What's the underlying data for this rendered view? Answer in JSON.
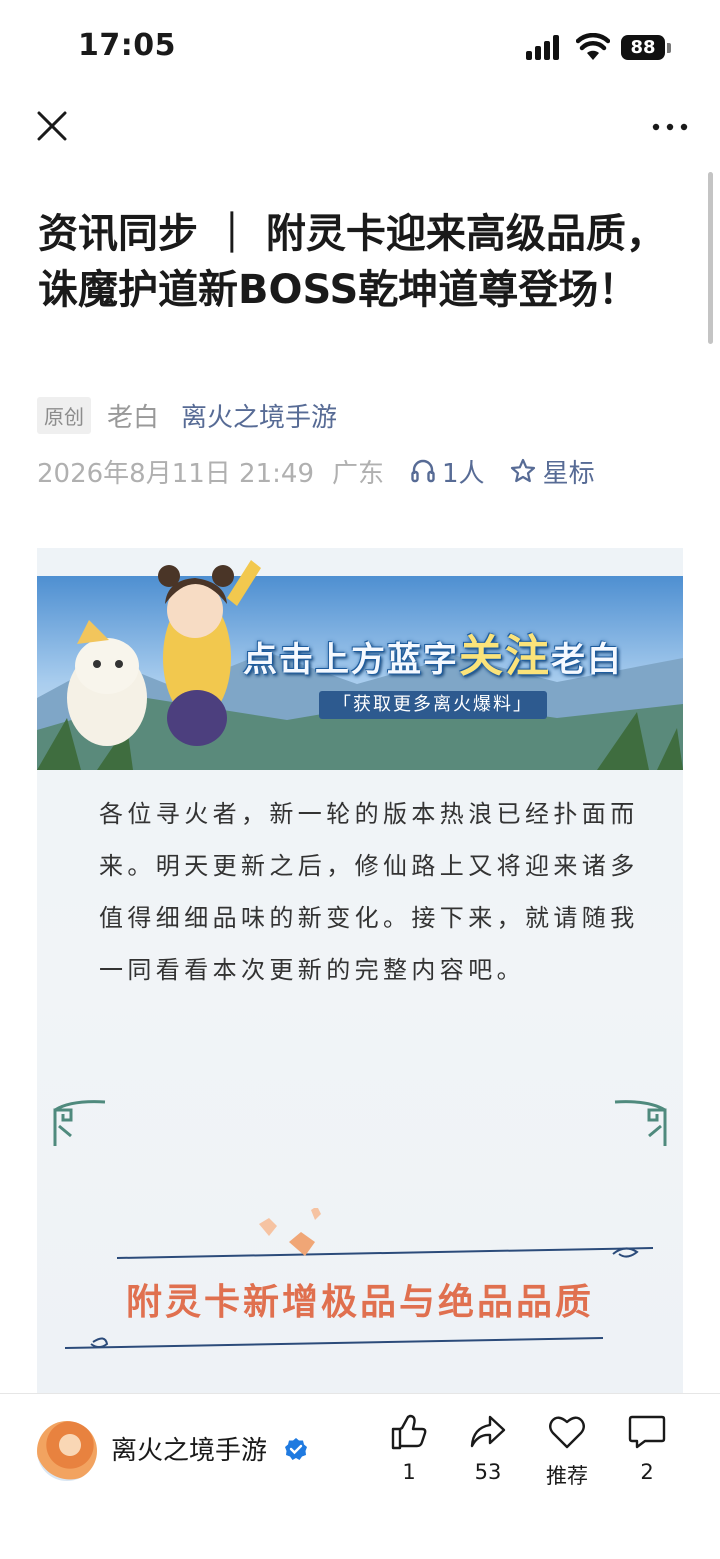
{
  "status_bar": {
    "time": "17:05",
    "battery": "88"
  },
  "article": {
    "title": "资讯同步 ｜ 附灵卡迎来高级品质，诛魔护道新BOSS乾坤道尊登场！",
    "original_badge": "原创",
    "author": "老白",
    "account": "离火之境手游",
    "date": "2026年8月11日 21:49",
    "region": "广东",
    "listeners": "1人",
    "star_label": "星标"
  },
  "banner": {
    "line1_prefix": "点击上方蓝字",
    "line1_highlight": "关注",
    "line1_suffix": "老白",
    "line2": "「获取更多离火爆料」"
  },
  "content": {
    "intro": "各位寻火者，新一轮的版本热浪已经扑面而来。明天更新之后，修仙路上又将迎来诸多值得细细品味的新变化。接下来，就请随我一同看看本次更新的完整内容吧。",
    "section_heading": "附灵卡新增极品与绝品品质"
  },
  "bottom_bar": {
    "account_name": "离火之境手游",
    "like_count": "1",
    "share_count": "53",
    "recommend_label": "推荐",
    "comment_count": "2"
  }
}
